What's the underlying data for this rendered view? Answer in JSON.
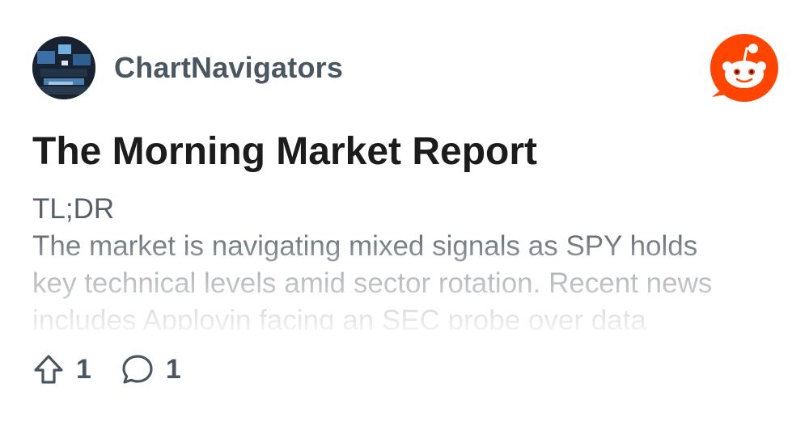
{
  "post": {
    "author": "ChartNavigators",
    "title": "The Morning Market Report",
    "body_lines": [
      "TL;DR",
      "The market is navigating mixed signals as SPY holds",
      "key technical levels amid sector rotation. Recent news",
      "includes Applovin facing an SEC probe over data"
    ],
    "upvotes": "1",
    "comments": "1"
  },
  "icons": {
    "logo": "reddit-logo-icon",
    "upvote": "upvote-arrow-icon",
    "comment": "comment-bubble-icon"
  },
  "colors": {
    "brand": "#ff4500",
    "text_muted": "#576068",
    "text_strong": "#1c1c1c"
  }
}
